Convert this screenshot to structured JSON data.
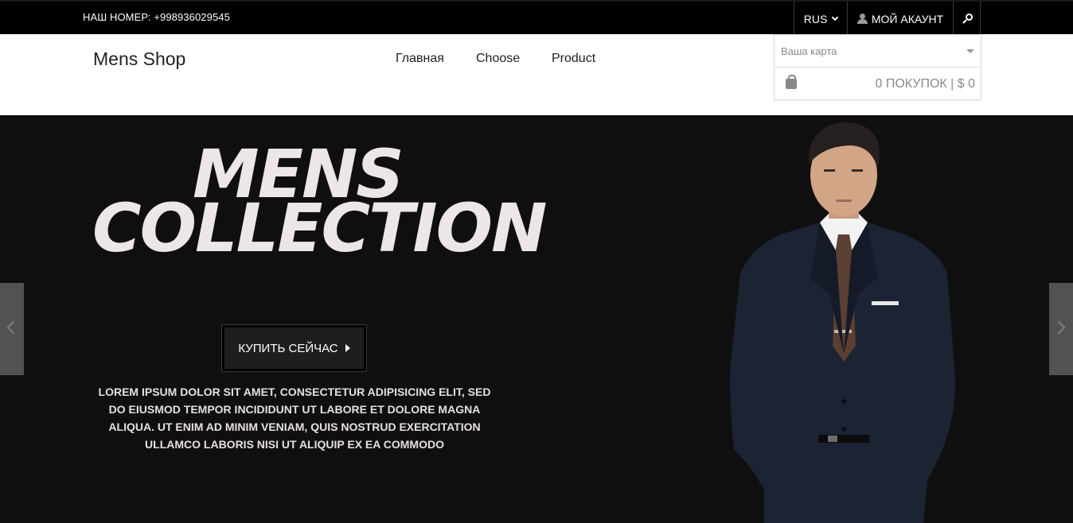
{
  "topbar": {
    "phone": "НАШ НОМЕР: +998936029545",
    "language": "RUS",
    "account": "МОЙ АКАУНТ",
    "icons": [
      "chevron-down-icon",
      "user-icon",
      "search-icon"
    ]
  },
  "header": {
    "logo": "Mens Shop",
    "nav": [
      "Главная",
      "Choose",
      "Product"
    ]
  },
  "cart": {
    "select_placeholder": "Ваша карта",
    "summary": "0 ПОКУПОК | $ 0"
  },
  "hero": {
    "title_line1": "MENS",
    "title_line2": "COLLECTION",
    "button_label": "КУПИТЬ СЕЙЧАС",
    "description": "LOREM IPSUM DOLOR SIT AMET, CONSECTETUR ADIPISICING ELIT, SED DO EIUSMOD TEMPOR INCIDIDUNT UT LABORE ET DOLORE MAGNA ALIQUA. UT ENIM AD MINIM VENIAM, QUIS NOSTRUD EXERCITATION ULLAMCO LABORIS NISI UT ALIQUIP EX EA COMMODO"
  },
  "colors": {
    "topbar_bg": "#000000",
    "hero_bg": "#100f0f",
    "hero_title": "#ede6e6"
  }
}
